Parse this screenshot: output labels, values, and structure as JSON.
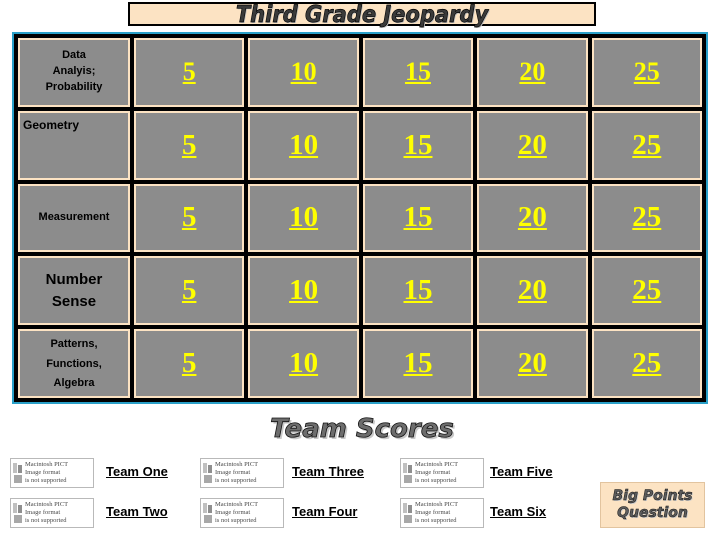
{
  "title": "Third Grade Jeopardy",
  "board": {
    "categories": [
      {
        "lines": [
          "Data",
          "Analyis;",
          "Probability"
        ]
      },
      {
        "lines": [
          "Geometry"
        ]
      },
      {
        "lines": [
          "Measurement"
        ]
      },
      {
        "lines": [
          "Number",
          "Sense"
        ]
      },
      {
        "lines": [
          "Patterns,",
          "Functions,",
          "Algebra"
        ]
      }
    ],
    "values": [
      [
        "5",
        "10",
        "15",
        "20",
        "25"
      ],
      [
        "5",
        "10",
        "15",
        "20",
        "25"
      ],
      [
        "5",
        "10",
        "15",
        "20",
        "25"
      ],
      [
        "5",
        "10",
        "15",
        "20",
        "25"
      ],
      [
        "5",
        "10",
        "15",
        "20",
        "25"
      ]
    ]
  },
  "team_scores_heading": "Team Scores",
  "placeholder_text": "Macintosh PICT\nImage format\nis not supported",
  "placeholders": [
    {
      "line1": "Macintosh PICT",
      "line2": "Image format",
      "line3": "is not supported"
    },
    {
      "line1": "Macintosh PICT",
      "line2": "Image format",
      "line3": "is not supported"
    },
    {
      "line1": "Macintosh PICT",
      "line2": "Image format",
      "line3": "is not supported"
    },
    {
      "line1": "Macintosh PICT",
      "line2": "Image format",
      "line3": "is not supported"
    },
    {
      "line1": "Macintosh PICT",
      "line2": "Image format",
      "line3": "is not supported"
    },
    {
      "line1": "Macintosh PICT",
      "line2": "Image format",
      "line3": "is not supported"
    }
  ],
  "teams": [
    {
      "label": "Team One"
    },
    {
      "label": "Team Two"
    },
    {
      "label": "Team Three"
    },
    {
      "label": "Team Four"
    },
    {
      "label": "Team Five"
    },
    {
      "label": "Team Six"
    }
  ],
  "big_points": {
    "line1": "Big Points",
    "line2": "Question"
  },
  "colors": {
    "board_bg": "#000000",
    "board_border": "#2aa0c8",
    "cell_bg": "#8c8c8c",
    "cell_border": "#fce3c3",
    "value_text": "#ffff00",
    "banner_bg": "#fce3c3"
  }
}
